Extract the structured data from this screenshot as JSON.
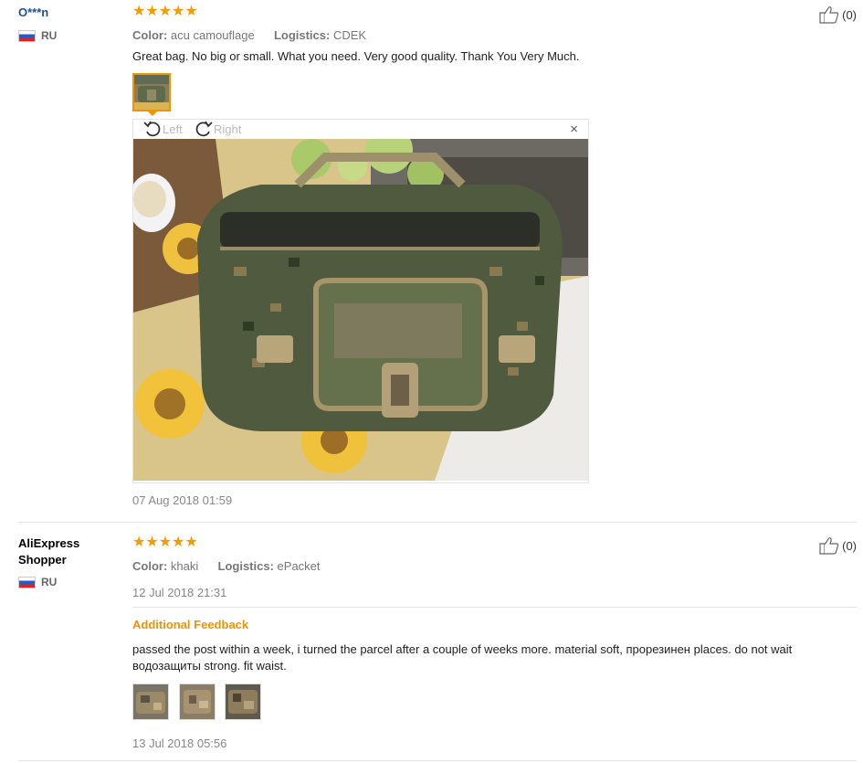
{
  "reviews": [
    {
      "user": "O***n",
      "country": "RU",
      "stars": "★★★★★",
      "color_label": "Color:",
      "color_value": "acu camouflage",
      "logistics_label": "Logistics:",
      "logistics_value": "CDEK",
      "text": "Great bag. No big or small. What you need. Very good quality. Thank You Very Much.",
      "helpful": "(0)",
      "viewer": {
        "left_label": "Left",
        "right_label": "Right",
        "close": "×"
      },
      "date": "07 Aug 2018 01:59"
    },
    {
      "user_line1": "AliExpress",
      "user_line2": "Shopper",
      "country": "RU",
      "stars": "★★★★★",
      "color_label": "Color:",
      "color_value": "khaki",
      "logistics_label": "Logistics:",
      "logistics_value": "ePacket",
      "date": "12 Jul 2018 21:31",
      "helpful": "(0)",
      "additional_title": "Additional Feedback",
      "additional_text": "passed the post within a week, i turned the parcel after a couple of weeks more. material soft, прорезинен places. do not wait водозащиты strong. fit waist.",
      "additional_date": "13 Jul 2018 05:56"
    }
  ],
  "colors": {
    "star": "#f79b00",
    "accent": "#f39200",
    "username": "#1c4f9c"
  }
}
